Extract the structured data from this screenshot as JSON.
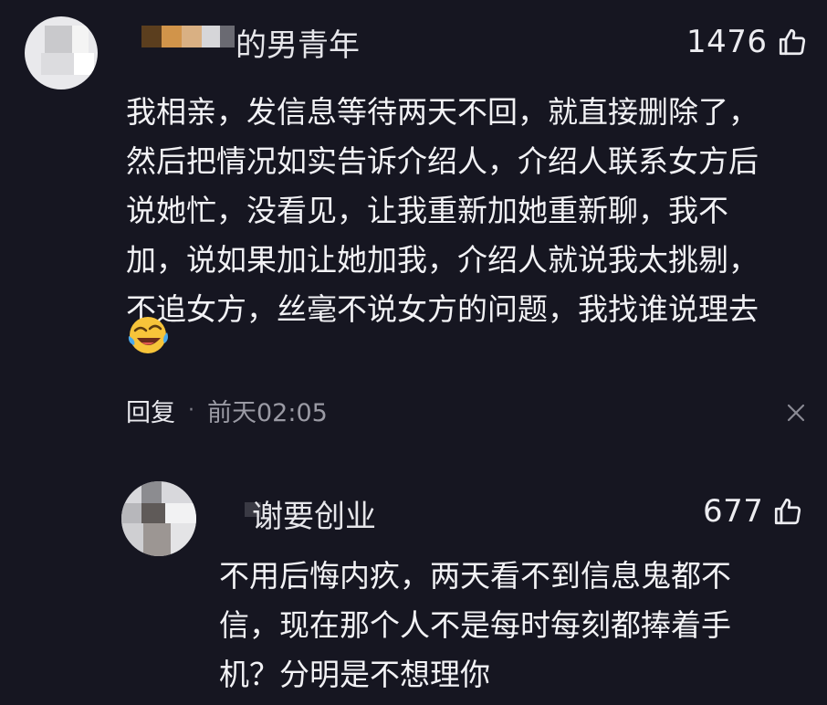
{
  "comment": {
    "username": "的男青年",
    "likes": "1476",
    "lines": [
      "我相亲，发信息等待两天不回，就直接删除了，",
      "然后把情况如实告诉介绍人，介绍人联系女方后",
      "说她忙，没看见，让我重新加她重新聊，我不",
      "加，说如果加让她加我，介绍人就说我太挑剔，",
      "不追女方，丝毫不说女方的问题，我找谁说理去"
    ],
    "emoji": "laughing-crying-emoji",
    "reply_label": "回复",
    "separator": "·",
    "time": "前天02:05",
    "icons": {
      "like": "thumbs-up-icon",
      "close": "close-icon"
    }
  },
  "reply": {
    "username": "谢要创业",
    "likes": "677",
    "lines": [
      "不用后悔内疚，两天看不到信息鬼都不",
      "信，现在那个人不是每时每刻都捧着手",
      "机？分明是不想理你"
    ]
  },
  "colors": {
    "background": "#161621",
    "text": "#f2f2f5",
    "meta": "#9a9aa4"
  }
}
